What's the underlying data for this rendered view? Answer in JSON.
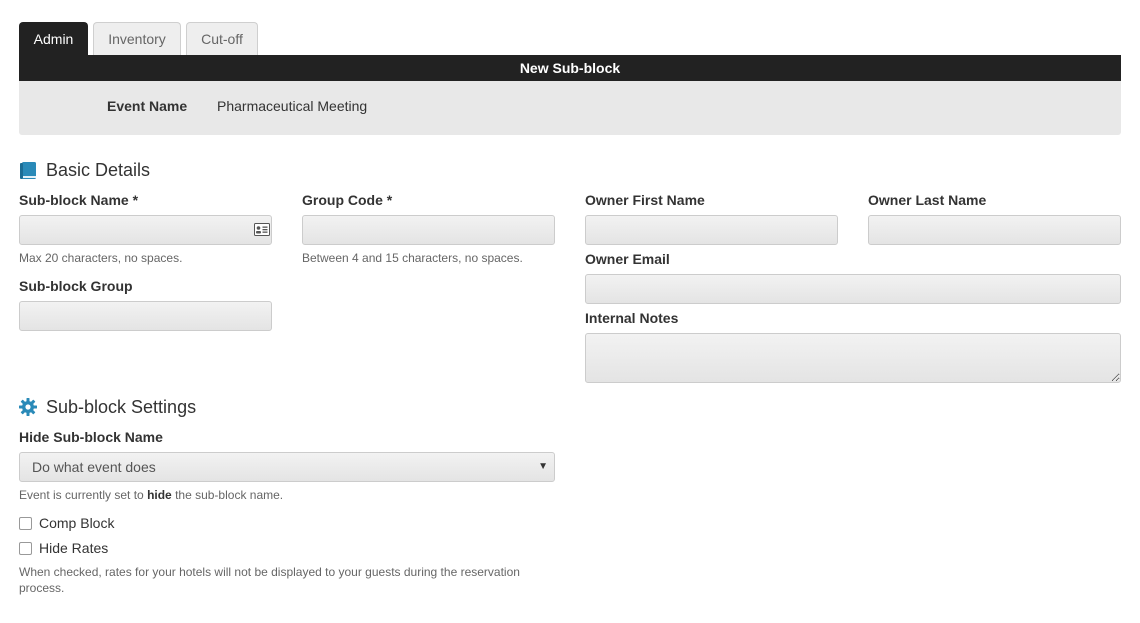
{
  "tabs": [
    {
      "label": "Admin",
      "active": true
    },
    {
      "label": "Inventory",
      "active": false
    },
    {
      "label": "Cut-off",
      "active": false
    }
  ],
  "header": {
    "title": "New Sub-block"
  },
  "event": {
    "label": "Event Name",
    "value": "Pharmaceutical Meeting"
  },
  "basic_details": {
    "title": "Basic Details",
    "icon": "book-icon",
    "sub_block_name": {
      "label": "Sub-block Name *",
      "value": "",
      "help": "Max 20 characters, no spaces.",
      "icon": "contact-card-icon"
    },
    "group_code": {
      "label": "Group Code *",
      "value": "",
      "help": "Between 4 and 15 characters, no spaces."
    },
    "sub_block_group": {
      "label": "Sub-block Group",
      "value": ""
    },
    "owner_first_name": {
      "label": "Owner First Name",
      "value": ""
    },
    "owner_last_name": {
      "label": "Owner Last Name",
      "value": ""
    },
    "owner_email": {
      "label": "Owner Email",
      "value": ""
    },
    "internal_notes": {
      "label": "Internal Notes",
      "value": ""
    }
  },
  "settings": {
    "title": "Sub-block Settings",
    "icon": "gear-icon",
    "hide_name": {
      "label": "Hide Sub-block Name",
      "selected": "Do what event does",
      "help_prefix": "Event is currently set to ",
      "help_bold": "hide",
      "help_suffix": " the sub-block name."
    },
    "comp_block": {
      "label": "Comp Block",
      "checked": false
    },
    "hide_rates": {
      "label": "Hide Rates",
      "checked": false,
      "help": "When checked, rates for your hotels will not be displayed to your guests during the reservation process."
    }
  },
  "colors": {
    "accent": "#2a8ab8",
    "dark_bar": "#222222",
    "panel": "#e8e8e8"
  }
}
